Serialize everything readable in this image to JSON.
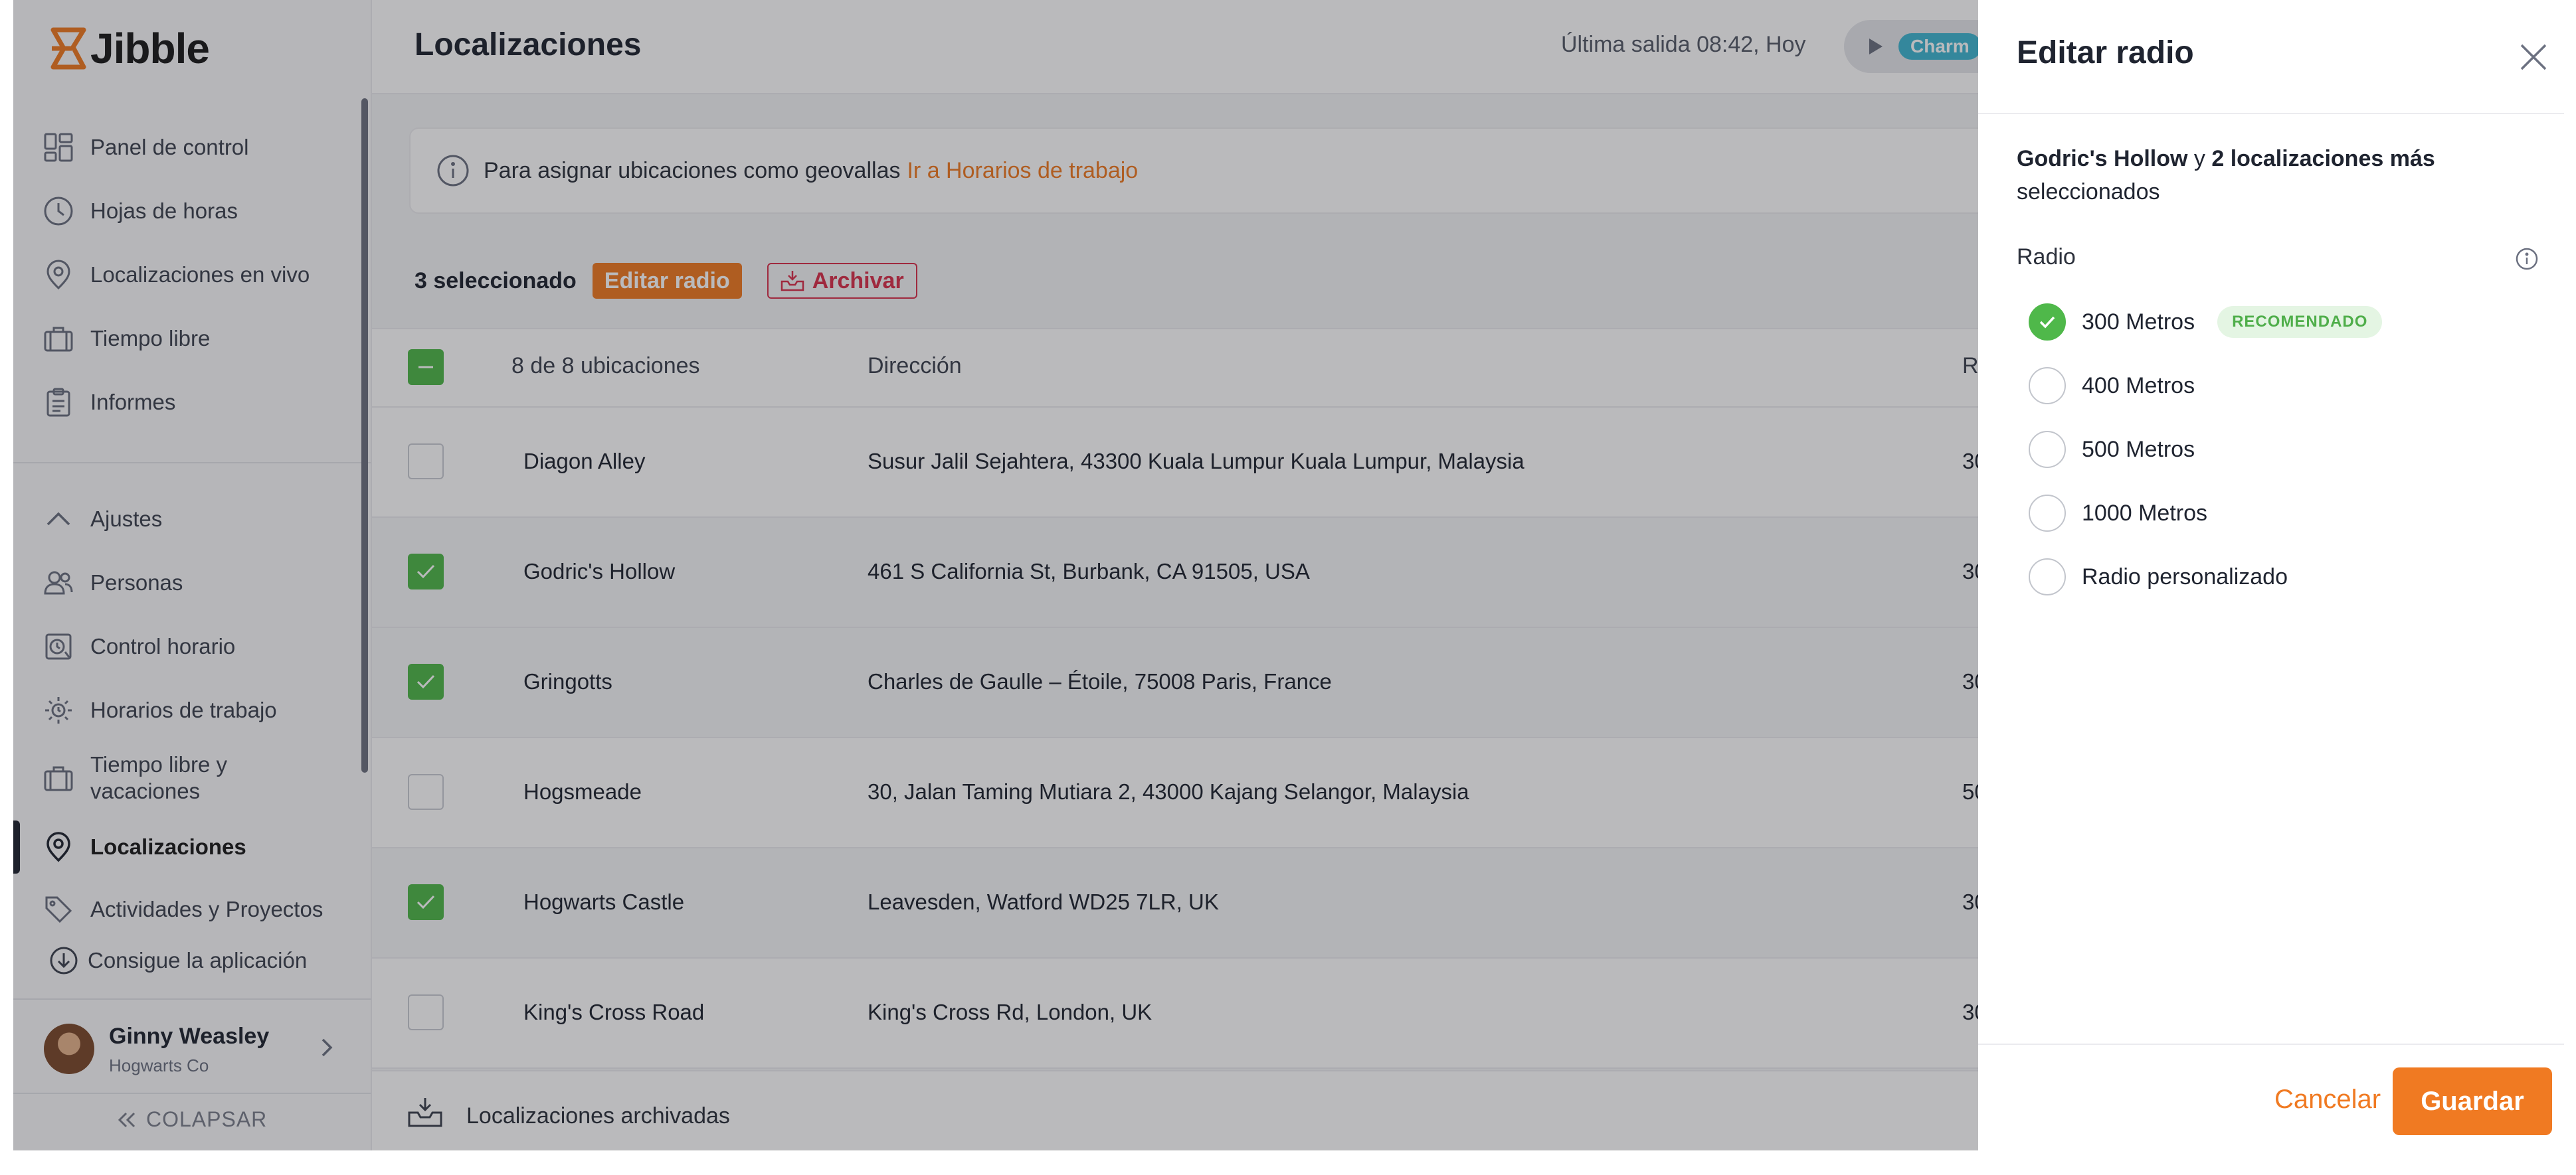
{
  "app": {
    "logo_text": "Jibble",
    "brand_color": "#f07a22"
  },
  "sidebar": {
    "items": [
      {
        "label": "Panel de control",
        "icon": "dashboard-icon"
      },
      {
        "label": "Hojas de horas",
        "icon": "clock-icon"
      },
      {
        "label": "Localizaciones en vivo",
        "icon": "location-pin-icon"
      },
      {
        "label": "Tiempo libre",
        "icon": "suitcase-icon"
      },
      {
        "label": "Informes",
        "icon": "clipboard-icon"
      }
    ],
    "settings_items": [
      {
        "label": "Ajustes",
        "icon": "chevron-up-icon"
      },
      {
        "label": "Personas",
        "icon": "people-icon"
      },
      {
        "label": "Control horario",
        "icon": "time-tracking-icon"
      },
      {
        "label": "Horarios de trabajo",
        "icon": "schedule-gear-icon"
      },
      {
        "label": "Tiempo libre y vacaciones",
        "icon": "suitcase-icon"
      },
      {
        "label": "Localizaciones",
        "icon": "location-pin-icon",
        "active": true
      },
      {
        "label": "Actividades y Proyectos",
        "icon": "tag-icon"
      }
    ],
    "get_app": "Consigue la aplicación",
    "user": {
      "name": "Ginny Weasley",
      "company": "Hogwarts Co"
    },
    "collapse": "COLAPSAR"
  },
  "header": {
    "title": "Localizaciones",
    "last_out": "Última salida 08:42, Hoy",
    "timer_badge": "Charm"
  },
  "banner": {
    "text": "Para asignar ubicaciones como geovallas",
    "link": "Ir a Horarios de trabajo"
  },
  "selection_bar": {
    "count": "3 seleccionado",
    "edit_radius": "Editar radio",
    "archive": "Archivar"
  },
  "table": {
    "headers": {
      "name": "8 de 8 ubicaciones",
      "address": "Dirección",
      "radius": "R"
    },
    "rows": [
      {
        "name": "Diagon Alley",
        "address": "Susur Jalil Sejahtera, 43300 Kuala Lumpur Kuala Lumpur, Malaysia",
        "radius": "30",
        "selected": false
      },
      {
        "name": "Godric's Hollow",
        "address": "461 S California St, Burbank, CA 91505, USA",
        "radius": "30",
        "selected": true
      },
      {
        "name": "Gringotts",
        "address": "Charles de Gaulle – Étoile, 75008 Paris, France",
        "radius": "30",
        "selected": true
      },
      {
        "name": "Hogsmeade",
        "address": "30, Jalan Taming Mutiara 2, 43000 Kajang Selangor, Malaysia",
        "radius": "50",
        "selected": false
      },
      {
        "name": "Hogwarts Castle",
        "address": "Leavesden, Watford WD25 7LR, UK",
        "radius": "30",
        "selected": true
      },
      {
        "name": "King's Cross Road",
        "address": "King's Cross Rd, London, UK",
        "radius": "30",
        "selected": false
      }
    ],
    "archived_link": "Localizaciones archivadas"
  },
  "drawer": {
    "title": "Editar radio",
    "selection_name": "Godric's Hollow",
    "selection_connector": "y",
    "selection_more": "2 localizaciones más",
    "selection_suffix": "seleccionados",
    "radius_label": "Radio",
    "options": [
      {
        "label": "300 Metros",
        "selected": true,
        "badge": "RECOMENDADO"
      },
      {
        "label": "400 Metros",
        "selected": false
      },
      {
        "label": "500 Metros",
        "selected": false
      },
      {
        "label": "1000 Metros",
        "selected": false
      },
      {
        "label": "Radio personalizado",
        "selected": false
      }
    ],
    "cancel": "Cancelar",
    "save": "Guardar"
  }
}
